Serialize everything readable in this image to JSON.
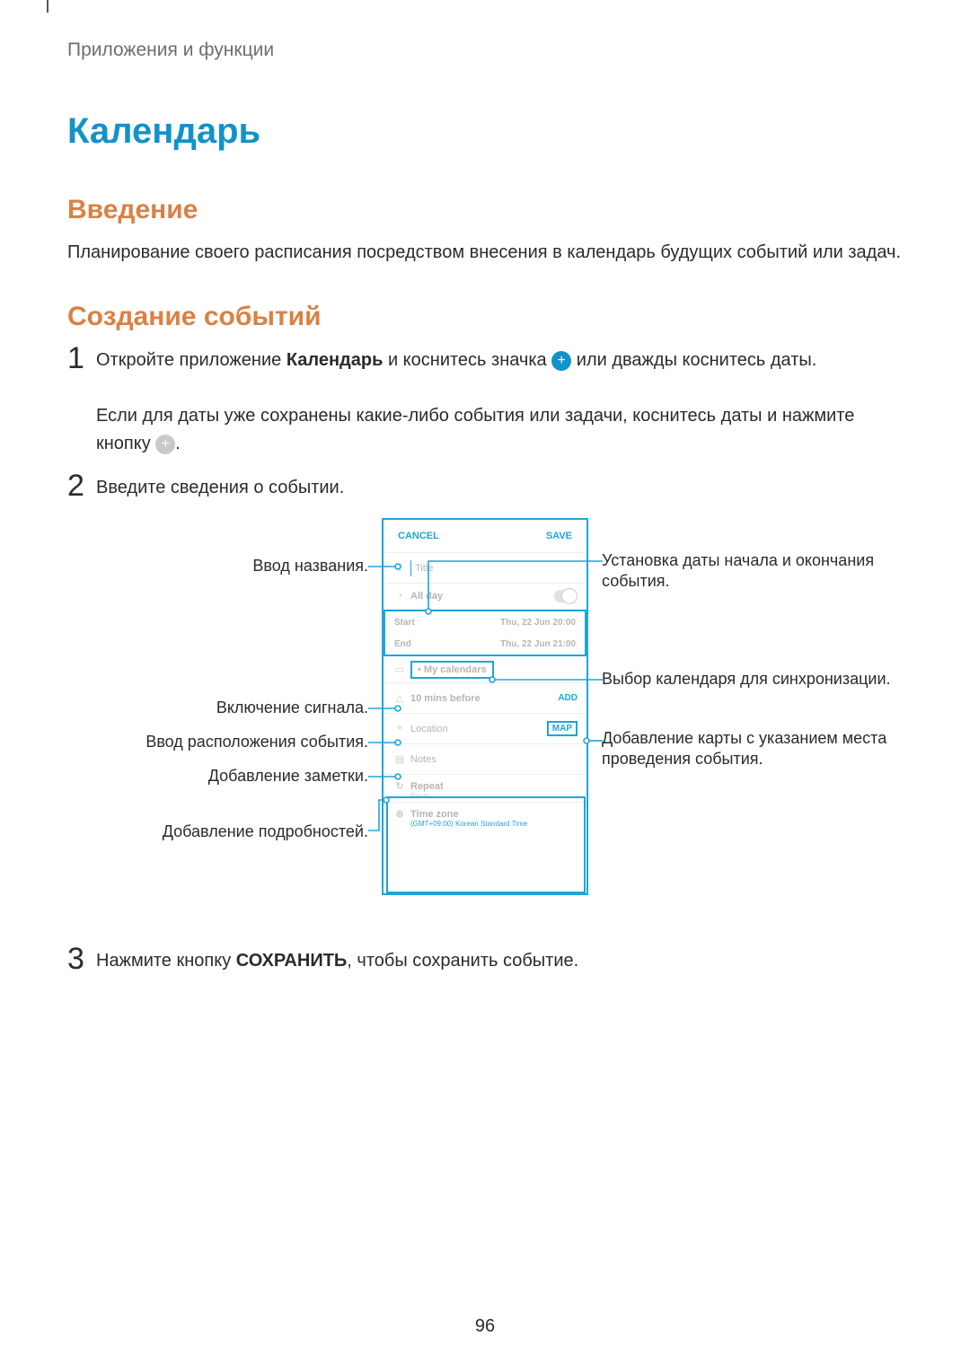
{
  "breadcrumb": "Приложения и функции",
  "h1": "Календарь",
  "intro": {
    "title": "Введение",
    "text": "Планирование своего расписания посредством внесения в календарь будущих событий или задач."
  },
  "create": {
    "title": "Создание событий"
  },
  "steps": {
    "one": {
      "num": "1",
      "pre": "Откройте приложение ",
      "app_bold": "Календарь",
      "mid": " и коснитесь значка ",
      "post": " или дважды коснитесь даты.",
      "line2_pre": "Если для даты уже сохранены какие-либо события или задачи, коснитесь даты и нажмите кнопку ",
      "line2_post": "."
    },
    "two": {
      "num": "2",
      "text": "Введите сведения о событии."
    },
    "three": {
      "num": "3",
      "pre": "Нажмите кнопку ",
      "bold": "СОХРАНИТЬ",
      "post": ", чтобы сохранить событие."
    }
  },
  "callouts": {
    "title_left": "Ввод названия.",
    "alarm_left": "Включение сигнала.",
    "location_left": "Ввод расположения события.",
    "notes_left": "Добавление заметки.",
    "details_left": "Добавление подробностей.",
    "dates_right": "Установка даты начала и окончания события.",
    "calendar_right": "Выбор календаря для синхронизации.",
    "map_right": "Добавление карты с указанием места проведения события."
  },
  "phone": {
    "cancel": "CANCEL",
    "save": "SAVE",
    "title_placeholder": "Title",
    "allday": "All day",
    "start_label": "Start",
    "start_value": "Thu, 22 Jun   20:00",
    "end_label": "End",
    "end_value": "Thu, 22 Jun   21:00",
    "my_calendars": "• My calendars",
    "alert_text": "10 mins before",
    "alert_add": "ADD",
    "location": "Location",
    "map": "MAP",
    "notes": "Notes",
    "repeat": "Repeat",
    "repeat_sub": "Never",
    "tz": "Time zone",
    "tz_sub": "(GMT+09:00) Korean Standard Time"
  },
  "page_number": "96"
}
